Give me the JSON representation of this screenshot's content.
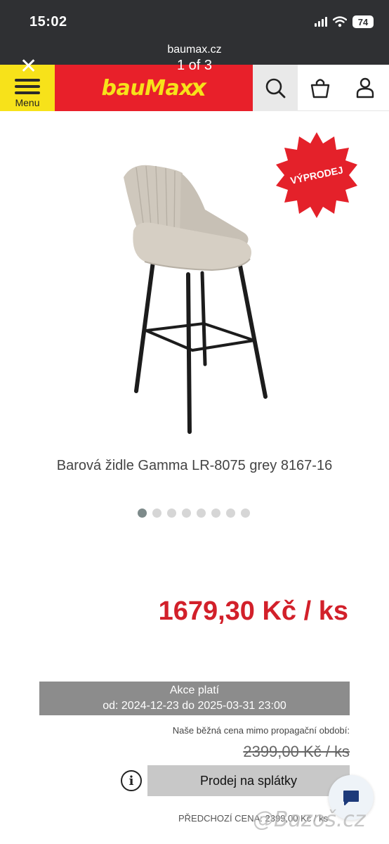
{
  "status": {
    "time": "15:02",
    "battery": "74"
  },
  "viewer": {
    "close": "✕",
    "url": "baumax.cz",
    "counter": "1 of 3"
  },
  "header": {
    "menu_label": "Menu",
    "logo": "bauMax",
    "logo_suffix": "x"
  },
  "product": {
    "badge": "VÝPRODEJ",
    "title": "Barová židle Gamma LR-8075 grey 8167-16",
    "image_count": 8,
    "active_image": 1,
    "price": "1679,30 Kč / ks"
  },
  "promo": {
    "line1": "Akce platí",
    "line2": "od: 2024-12-23 do 2025-03-31 23:00"
  },
  "pricing": {
    "normal_note": "Naše běžná cena mimo propagační období:",
    "old_price": "2399,00 Kč / ks",
    "installments_button": "Prodej na splátky",
    "info_icon": "i",
    "previous_price": "PŘEDCHOZÍ CENA: 2399,00 Kč / ks"
  },
  "watermark": "@Bazoš.cz",
  "colors": {
    "accent_red": "#e8202a",
    "accent_yellow": "#f7e21a",
    "price_red": "#d2202a",
    "promo_grey": "#8c8c8c"
  }
}
